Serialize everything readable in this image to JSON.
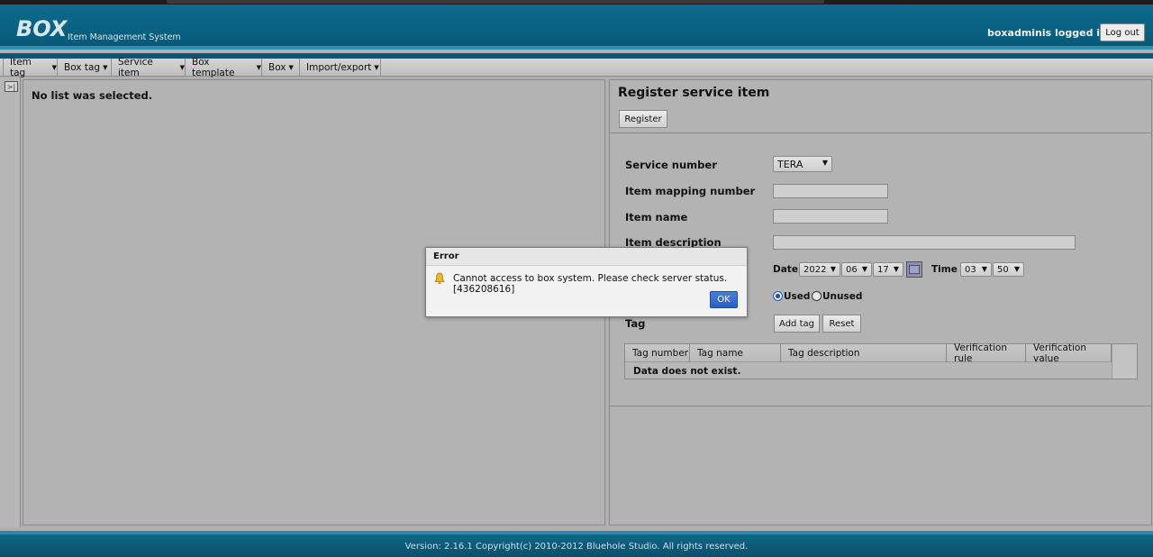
{
  "header": {
    "logo": "BOX",
    "subtitle": "Item Management System",
    "login_status": "boxadminis logged in.",
    "logout_label": "Log out"
  },
  "menu": {
    "items": [
      {
        "label": "Item tag"
      },
      {
        "label": "Box tag"
      },
      {
        "label": "Service item"
      },
      {
        "label": "Box template"
      },
      {
        "label": "Box"
      },
      {
        "label": "Import/export"
      }
    ]
  },
  "left_panel": {
    "message": "No list was selected."
  },
  "form": {
    "title": "Register service item",
    "register_label": "Register",
    "service_number_label": "Service number",
    "service_number_value": "TERA",
    "mapping_label": "Item mapping number",
    "item_name_label": "Item name",
    "item_description_label": "Item description",
    "date_label": "Date",
    "year": "2022",
    "month": "06",
    "day": "17",
    "time_label": "Time",
    "hour": "03",
    "minute": "50",
    "used_label": "Used",
    "unused_label": "Unused",
    "tag_label": "Tag",
    "add_tag_label": "Add tag",
    "reset_label": "Reset"
  },
  "tag_table": {
    "columns": [
      "Tag number",
      "Tag name",
      "Tag description",
      "Verification rule",
      "Verification value"
    ],
    "empty_message": "Data does not exist."
  },
  "dialog": {
    "title": "Error",
    "message": "Cannot access to box system. Please check server status. [436208616]",
    "ok_label": "OK"
  },
  "footer": {
    "text": "Version: 2.16.1 Copyright(c) 2010-2012 Bluehole Studio. All rights reserved."
  }
}
